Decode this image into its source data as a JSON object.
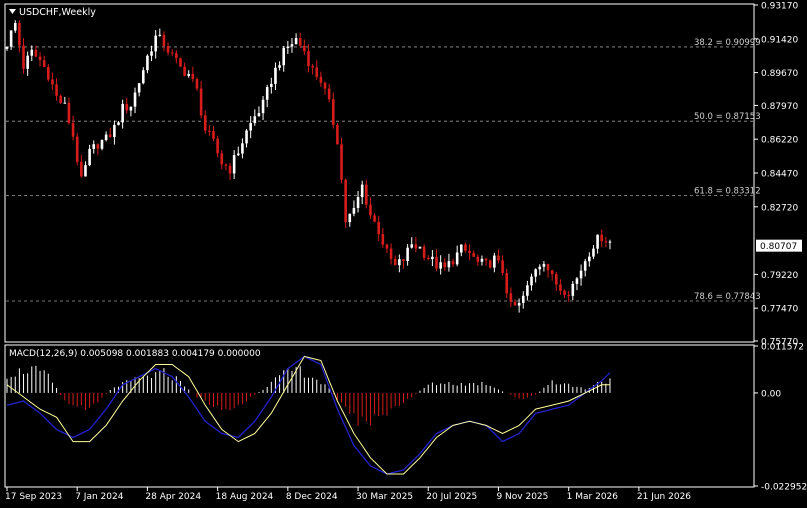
{
  "symbol_label": "USDCHF,Weekly",
  "macd_label": "MACD(12,26,9) 0.005098 0.001883 0.004179 0.000000",
  "colors": {
    "background": "#000000",
    "frame": "#ffffff",
    "bull": "#ffffff",
    "bear": "#d81b1b",
    "grid_dash": "#9a9a9a",
    "macd_line": "#2222cc",
    "signal_line": "#ffff9a",
    "current_price_box": "#ffffff"
  },
  "chart_data": [
    {
      "type": "candlestick",
      "title": "USDCHF,Weekly",
      "ylim": [
        0.7577,
        0.9317
      ],
      "y_ticks": [
        "0.93170",
        "0.91420",
        "0.89670",
        "0.87970",
        "0.86220",
        "0.84470",
        "0.82720",
        "0.80707",
        "0.79220",
        "0.77470",
        "0.75770"
      ],
      "current_price": "0.80707",
      "x_ticks": [
        "17 Sep 2023",
        "7 Jan 2024",
        "28 Apr 2024",
        "18 Aug 2024",
        "8 Dec 2024",
        "30 Mar 2025",
        "20 Jul 2025",
        "9 Nov 2025",
        "1 Mar 2026",
        "21 Jun 2026"
      ],
      "fib_levels": [
        {
          "label": "38.2 = 0.90999",
          "value": 0.90999
        },
        {
          "label": "50.0 = 0.87153",
          "value": 0.87153
        },
        {
          "label": "61.8 = 0.83312",
          "value": 0.83312
        },
        {
          "label": "78.6 = 0.77843",
          "value": 0.77843
        }
      ],
      "close_path": [
        [
          0,
          0.912
        ],
        [
          2,
          0.922
        ],
        [
          4,
          0.9
        ],
        [
          6,
          0.907
        ],
        [
          8,
          0.903
        ],
        [
          10,
          0.896
        ],
        [
          12,
          0.884
        ],
        [
          14,
          0.879
        ],
        [
          16,
          0.864
        ],
        [
          18,
          0.84
        ],
        [
          20,
          0.855
        ],
        [
          22,
          0.86
        ],
        [
          24,
          0.862
        ],
        [
          26,
          0.868
        ],
        [
          28,
          0.878
        ],
        [
          30,
          0.88
        ],
        [
          32,
          0.892
        ],
        [
          34,
          0.905
        ],
        [
          36,
          0.915
        ],
        [
          38,
          0.912
        ],
        [
          40,
          0.905
        ],
        [
          42,
          0.899
        ],
        [
          44,
          0.896
        ],
        [
          46,
          0.887
        ],
        [
          48,
          0.867
        ],
        [
          50,
          0.86
        ],
        [
          52,
          0.85
        ],
        [
          54,
          0.847
        ],
        [
          56,
          0.856
        ],
        [
          58,
          0.866
        ],
        [
          60,
          0.874
        ],
        [
          62,
          0.88
        ],
        [
          64,
          0.893
        ],
        [
          66,
          0.903
        ],
        [
          68,
          0.91
        ],
        [
          70,
          0.914
        ],
        [
          72,
          0.908
        ],
        [
          74,
          0.898
        ],
        [
          76,
          0.893
        ],
        [
          78,
          0.88
        ],
        [
          80,
          0.862
        ],
        [
          82,
          0.82
        ],
        [
          84,
          0.825
        ],
        [
          86,
          0.838
        ],
        [
          88,
          0.823
        ],
        [
          90,
          0.815
        ],
        [
          92,
          0.803
        ],
        [
          94,
          0.796
        ],
        [
          96,
          0.8
        ],
        [
          98,
          0.808
        ],
        [
          100,
          0.806
        ],
        [
          102,
          0.801
        ],
        [
          104,
          0.797
        ],
        [
          106,
          0.795
        ],
        [
          108,
          0.8
        ],
        [
          110,
          0.805
        ],
        [
          112,
          0.803
        ],
        [
          114,
          0.798
        ],
        [
          116,
          0.797
        ],
        [
          118,
          0.8
        ],
        [
          120,
          0.794
        ],
        [
          122,
          0.775
        ],
        [
          124,
          0.776
        ],
        [
          126,
          0.785
        ],
        [
          128,
          0.796
        ],
        [
          130,
          0.8
        ],
        [
          132,
          0.79
        ],
        [
          134,
          0.785
        ],
        [
          136,
          0.784
        ],
        [
          138,
          0.79
        ],
        [
          140,
          0.8
        ],
        [
          142,
          0.808
        ],
        [
          144,
          0.812
        ],
        [
          146,
          0.809
        ]
      ],
      "candle_count": 147,
      "bars_per_x_tick": 17
    },
    {
      "type": "macd",
      "title": "MACD(12,26,9) 0.005098 0.001883 0.004179 0.000000",
      "ylim": [
        -0.022952,
        0.011572
      ],
      "y_ticks": [
        "0.011572",
        "0.00",
        "-0.022952"
      ],
      "histogram_path": [
        [
          0,
          0.0045
        ],
        [
          6,
          0.006
        ],
        [
          10,
          0.004
        ],
        [
          14,
          -0.002
        ],
        [
          18,
          -0.004
        ],
        [
          22,
          -0.002
        ],
        [
          26,
          0.0015
        ],
        [
          32,
          0.0035
        ],
        [
          38,
          0.005
        ],
        [
          42,
          0.003
        ],
        [
          46,
          -0.001
        ],
        [
          50,
          -0.003
        ],
        [
          54,
          -0.0045
        ],
        [
          58,
          -0.002
        ],
        [
          62,
          0.001
        ],
        [
          66,
          0.004
        ],
        [
          70,
          0.006
        ],
        [
          74,
          0.004
        ],
        [
          78,
          0.001
        ],
        [
          82,
          -0.004
        ],
        [
          86,
          -0.0075
        ],
        [
          90,
          -0.006
        ],
        [
          94,
          -0.004
        ],
        [
          98,
          -0.001
        ],
        [
          102,
          0.002
        ],
        [
          106,
          0.0025
        ],
        [
          110,
          0.0022
        ],
        [
          116,
          0.0024
        ],
        [
          122,
          -0.0005
        ],
        [
          124,
          -0.0015
        ],
        [
          128,
          -0.0005
        ],
        [
          132,
          0.003
        ],
        [
          136,
          0.002
        ],
        [
          140,
          0.001
        ],
        [
          144,
          0.003
        ],
        [
          146,
          0.003
        ]
      ],
      "macd_path": [
        [
          0,
          -0.003
        ],
        [
          4,
          -0.002
        ],
        [
          8,
          -0.005
        ],
        [
          12,
          -0.009
        ],
        [
          16,
          -0.011
        ],
        [
          20,
          -0.009
        ],
        [
          24,
          -0.004
        ],
        [
          28,
          0.002
        ],
        [
          32,
          0.004
        ],
        [
          36,
          0.006
        ],
        [
          40,
          0.004
        ],
        [
          44,
          -0.001
        ],
        [
          48,
          -0.007
        ],
        [
          52,
          -0.01
        ],
        [
          56,
          -0.011
        ],
        [
          60,
          -0.007
        ],
        [
          64,
          -0.001
        ],
        [
          68,
          0.006
        ],
        [
          72,
          0.009
        ],
        [
          76,
          0.007
        ],
        [
          80,
          -0.004
        ],
        [
          84,
          -0.013
        ],
        [
          88,
          -0.018
        ],
        [
          92,
          -0.02
        ],
        [
          96,
          -0.019
        ],
        [
          100,
          -0.015
        ],
        [
          104,
          -0.01
        ],
        [
          108,
          -0.008
        ],
        [
          112,
          -0.007
        ],
        [
          116,
          -0.008
        ],
        [
          120,
          -0.012
        ],
        [
          124,
          -0.01
        ],
        [
          128,
          -0.005
        ],
        [
          132,
          -0.004
        ],
        [
          136,
          -0.003
        ],
        [
          140,
          0.0
        ],
        [
          144,
          0.003
        ],
        [
          146,
          0.005
        ]
      ],
      "signal_path": [
        [
          0,
          0.002
        ],
        [
          4,
          -0.001
        ],
        [
          8,
          -0.004
        ],
        [
          12,
          -0.006
        ],
        [
          16,
          -0.012
        ],
        [
          20,
          -0.012
        ],
        [
          24,
          -0.008
        ],
        [
          28,
          -0.002
        ],
        [
          32,
          0.003
        ],
        [
          36,
          0.007
        ],
        [
          40,
          0.007
        ],
        [
          44,
          0.004
        ],
        [
          48,
          -0.003
        ],
        [
          52,
          -0.009
        ],
        [
          56,
          -0.012
        ],
        [
          60,
          -0.01
        ],
        [
          64,
          -0.005
        ],
        [
          68,
          0.002
        ],
        [
          72,
          0.009
        ],
        [
          76,
          0.008
        ],
        [
          80,
          -0.002
        ],
        [
          84,
          -0.01
        ],
        [
          88,
          -0.016
        ],
        [
          92,
          -0.02
        ],
        [
          96,
          -0.02
        ],
        [
          100,
          -0.016
        ],
        [
          104,
          -0.011
        ],
        [
          108,
          -0.008
        ],
        [
          112,
          -0.007
        ],
        [
          116,
          -0.008
        ],
        [
          120,
          -0.01
        ],
        [
          124,
          -0.008
        ],
        [
          128,
          -0.004
        ],
        [
          132,
          -0.003
        ],
        [
          136,
          -0.002
        ],
        [
          140,
          0.0
        ],
        [
          144,
          0.002
        ],
        [
          146,
          0.002
        ]
      ]
    }
  ]
}
